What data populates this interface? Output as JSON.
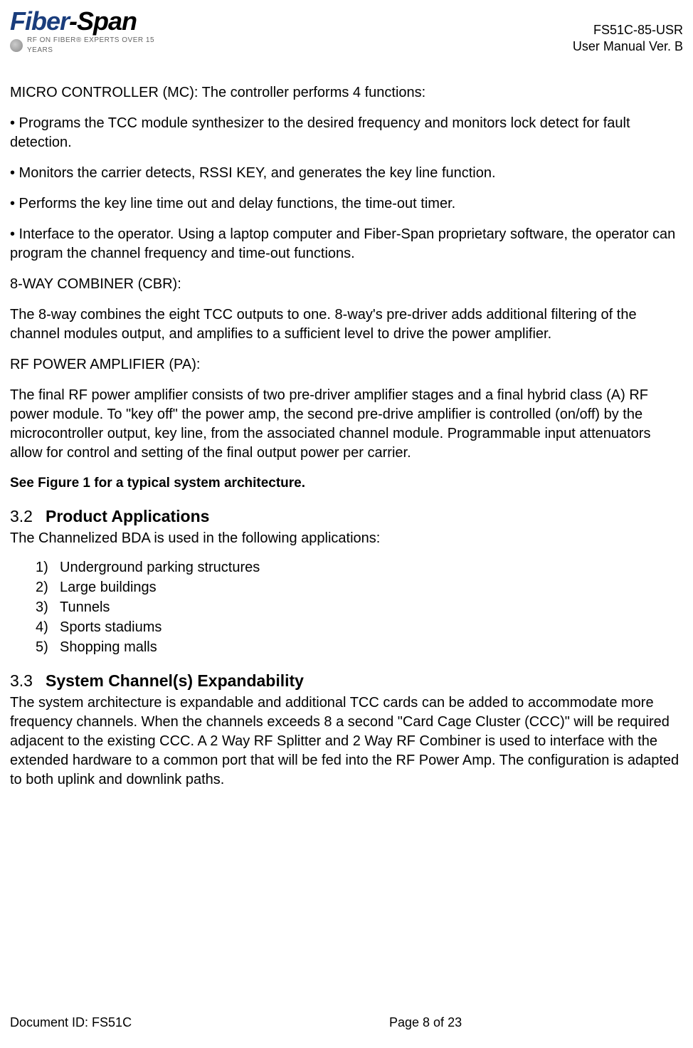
{
  "header": {
    "logo_main_1": "Fiber",
    "logo_main_dash": "-",
    "logo_main_2": "Span",
    "logo_sub": "RF ON FIBER® EXPERTS OVER 15 YEARS",
    "doc_code": "FS51C-85-USR",
    "doc_version": "User Manual Ver. B"
  },
  "content": {
    "mc_intro": "MICRO CONTROLLER (MC): The controller performs 4 functions:",
    "bullets": [
      "•   Programs the TCC module synthesizer to the desired frequency and monitors lock detect for fault detection.",
      "•   Monitors the carrier detects, RSSI KEY, and generates the key line function.",
      "•   Performs the key line time out and delay functions, the time-out timer.",
      "•   Interface to the operator. Using a laptop computer and Fiber-Span proprietary software, the operator can program the channel frequency and time-out functions."
    ],
    "cbr_heading": "8-WAY COMBINER (CBR):",
    "cbr_body": "The 8-way combines the eight TCC outputs to one. 8-way's pre-driver adds additional filtering of the channel modules output, and amplifies to a sufficient level to drive the power amplifier.",
    "pa_heading": "RF POWER AMPLIFIER (PA):",
    "pa_body": "The final RF power amplifier consists of two  pre-driver amplifier stages and a final hybrid class (A) RF power module. To \"key off\" the power amp, the second pre-drive amplifier is controlled (on/off) by the microcontroller output, key line, from the associated channel module. Programmable input attenuators allow for control and setting of the final output power per carrier.",
    "see_figure": "See  Figure 1 for a typical system architecture.",
    "sec32_num": "3.2",
    "sec32_title": "Product Applications",
    "sec32_intro": "The Channelized BDA is used in the following applications:",
    "sec32_list": [
      {
        "num": "1)",
        "text": "Underground parking structures"
      },
      {
        "num": "2)",
        "text": "Large buildings"
      },
      {
        "num": "3)",
        "text": "Tunnels"
      },
      {
        "num": "4)",
        "text": "Sports stadiums"
      },
      {
        "num": "5)",
        "text": "Shopping malls"
      }
    ],
    "sec33_num": "3.3",
    "sec33_title": "System Channel(s) Expandability",
    "sec33_body": "The system architecture is expandable and additional TCC cards can be added to accommodate more frequency channels.  When the channels exceeds 8 a second \"Card Cage Cluster (CCC)\" will be required adjacent to the existing CCC.  A 2 Way RF Splitter and 2 Way RF Combiner is used to interface with the extended hardware to a common port that will be fed into the RF Power Amp.  The configuration is adapted to both uplink and downlink paths."
  },
  "footer": {
    "doc_id": "Document ID: FS51C",
    "page": "Page 8 of 23"
  }
}
